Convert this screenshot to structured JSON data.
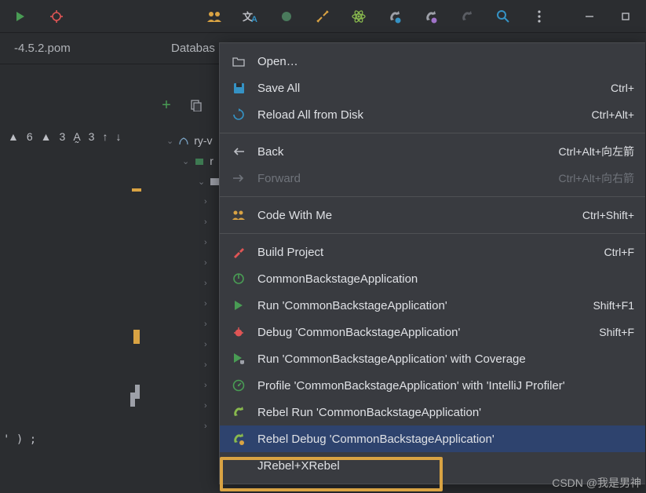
{
  "toolbar": {
    "tab_file": "-4.5.2.pom",
    "db_title": "Databas"
  },
  "gutter": {
    "warn1_count": "6",
    "warn2_count": "3",
    "typo_count": "3"
  },
  "tree": {
    "crumb1": "ry-v",
    "crumb2": "r",
    "menu_label": "Databas"
  },
  "code": "' ) ;",
  "menu": {
    "open": "Open…",
    "save_all": "Save All",
    "save_all_sc": "Ctrl+",
    "reload": "Reload All from Disk",
    "reload_sc": "Ctrl+Alt+",
    "back": "Back",
    "back_sc": "Ctrl+Alt+向左箭",
    "forward": "Forward",
    "forward_sc": "Ctrl+Alt+向右箭",
    "cwm": "Code With Me",
    "cwm_sc": "Ctrl+Shift+",
    "build": "Build Project",
    "build_sc": "Ctrl+F",
    "stop": "CommonBackstageApplication",
    "run": "Run 'CommonBackstageApplication'",
    "run_sc": "Shift+F1",
    "debug": "Debug 'CommonBackstageApplication'",
    "debug_sc": "Shift+F",
    "cov": "Run 'CommonBackstageApplication' with Coverage",
    "profile": "Profile 'CommonBackstageApplication' with 'IntelliJ Profiler'",
    "rrun": "Rebel Run 'CommonBackstageApplication'",
    "rdebug": "Rebel Debug 'CommonBackstageApplication'",
    "jx": "JRebel+XRebel"
  },
  "watermark": "CSDN @我是男神"
}
